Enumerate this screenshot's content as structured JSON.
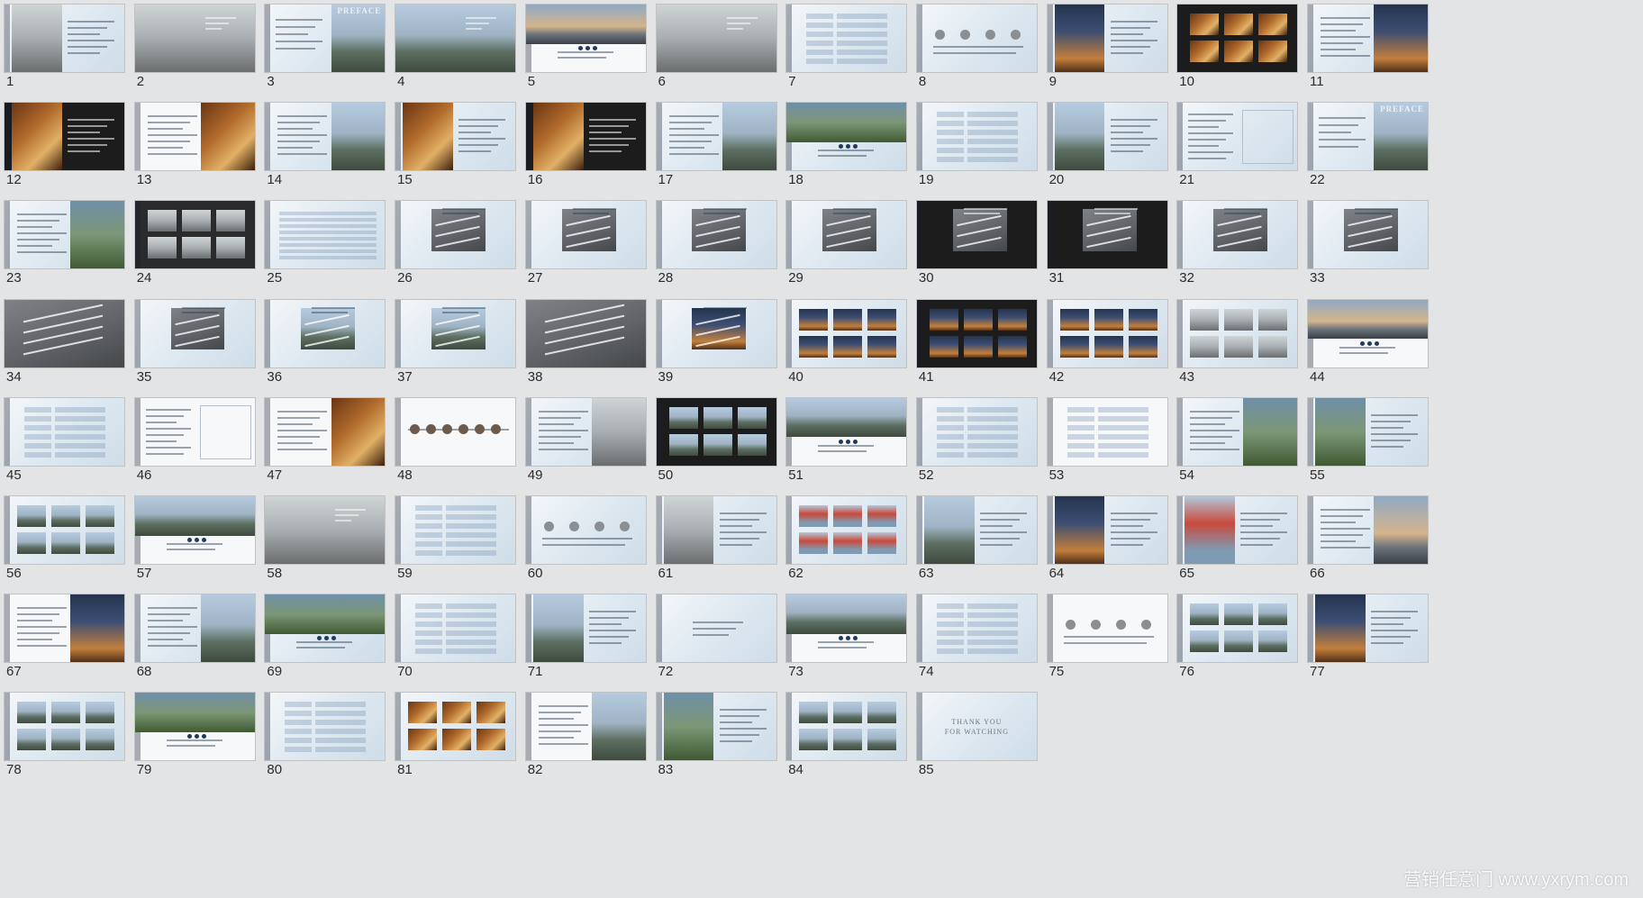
{
  "slides": [
    {
      "n": "1",
      "style": "light",
      "kind": "photo-left",
      "photo": "car"
    },
    {
      "n": "2",
      "style": "dark",
      "kind": "photo-full",
      "photo": "car"
    },
    {
      "n": "3",
      "style": "light",
      "kind": "preface",
      "photo": "city",
      "title": "PREFACE"
    },
    {
      "n": "4",
      "style": "light",
      "kind": "photo-full",
      "photo": "city"
    },
    {
      "n": "5",
      "style": "white",
      "kind": "photo-top",
      "photo": "sunset"
    },
    {
      "n": "6",
      "style": "light",
      "kind": "photo-full",
      "photo": "car"
    },
    {
      "n": "7",
      "style": "light",
      "kind": "rows"
    },
    {
      "n": "8",
      "style": "light",
      "kind": "circles"
    },
    {
      "n": "9",
      "style": "light",
      "kind": "photo-left",
      "photo": "night"
    },
    {
      "n": "10",
      "style": "black",
      "kind": "grid-photos",
      "photo": "food"
    },
    {
      "n": "11",
      "style": "light",
      "kind": "photo-right",
      "photo": "night"
    },
    {
      "n": "12",
      "style": "black",
      "kind": "photo-left",
      "photo": "food"
    },
    {
      "n": "13",
      "style": "white",
      "kind": "photo-right",
      "photo": "food"
    },
    {
      "n": "14",
      "style": "light",
      "kind": "photo-right",
      "photo": "city"
    },
    {
      "n": "15",
      "style": "light",
      "kind": "photo-left",
      "photo": "food"
    },
    {
      "n": "16",
      "style": "black",
      "kind": "photo-left",
      "photo": "food"
    },
    {
      "n": "17",
      "style": "light",
      "kind": "photo-right",
      "photo": "city"
    },
    {
      "n": "18",
      "style": "light",
      "kind": "photo-top",
      "photo": "green"
    },
    {
      "n": "19",
      "style": "light",
      "kind": "rows"
    },
    {
      "n": "20",
      "style": "light",
      "kind": "photo-left",
      "photo": "city"
    },
    {
      "n": "21",
      "style": "light",
      "kind": "text-map"
    },
    {
      "n": "22",
      "style": "light",
      "kind": "preface",
      "photo": "city",
      "title": "PREFACE"
    },
    {
      "n": "23",
      "style": "light",
      "kind": "photo-right",
      "photo": "green"
    },
    {
      "n": "24",
      "style": "dark",
      "kind": "grid-photos",
      "photo": "car"
    },
    {
      "n": "25",
      "style": "light",
      "kind": "table"
    },
    {
      "n": "26",
      "style": "light",
      "kind": "render",
      "photo": "3d"
    },
    {
      "n": "27",
      "style": "light",
      "kind": "render",
      "photo": "3d"
    },
    {
      "n": "28",
      "style": "light",
      "kind": "render",
      "photo": "3d"
    },
    {
      "n": "29",
      "style": "light",
      "kind": "render",
      "photo": "3d"
    },
    {
      "n": "30",
      "style": "black",
      "kind": "render",
      "photo": "3d"
    },
    {
      "n": "31",
      "style": "black",
      "kind": "render",
      "photo": "3d"
    },
    {
      "n": "32",
      "style": "light",
      "kind": "render",
      "photo": "3d"
    },
    {
      "n": "33",
      "style": "light",
      "kind": "render",
      "photo": "3d"
    },
    {
      "n": "34",
      "style": "dark",
      "kind": "render-full",
      "photo": "3d"
    },
    {
      "n": "35",
      "style": "light",
      "kind": "render",
      "photo": "3d"
    },
    {
      "n": "36",
      "style": "light",
      "kind": "render",
      "photo": "city"
    },
    {
      "n": "37",
      "style": "light",
      "kind": "render",
      "photo": "city"
    },
    {
      "n": "38",
      "style": "dark",
      "kind": "render-full",
      "photo": "3d"
    },
    {
      "n": "39",
      "style": "light",
      "kind": "render",
      "photo": "night"
    },
    {
      "n": "40",
      "style": "light",
      "kind": "grid-photos",
      "photo": "night"
    },
    {
      "n": "41",
      "style": "black",
      "kind": "grid-photos",
      "photo": "night"
    },
    {
      "n": "42",
      "style": "light",
      "kind": "grid-photos",
      "photo": "night"
    },
    {
      "n": "43",
      "style": "light",
      "kind": "grid-photos",
      "photo": "car"
    },
    {
      "n": "44",
      "style": "white",
      "kind": "photo-top",
      "photo": "sunset"
    },
    {
      "n": "45",
      "style": "light",
      "kind": "rows"
    },
    {
      "n": "46",
      "style": "white",
      "kind": "text-map"
    },
    {
      "n": "47",
      "style": "white",
      "kind": "photo-right",
      "photo": "food"
    },
    {
      "n": "48",
      "style": "white",
      "kind": "timeline"
    },
    {
      "n": "49",
      "style": "light",
      "kind": "photo-right",
      "photo": "car"
    },
    {
      "n": "50",
      "style": "black",
      "kind": "grid-photos",
      "photo": "city"
    },
    {
      "n": "51",
      "style": "white",
      "kind": "photo-top",
      "photo": "city"
    },
    {
      "n": "52",
      "style": "light",
      "kind": "rows"
    },
    {
      "n": "53",
      "style": "white",
      "kind": "rows"
    },
    {
      "n": "54",
      "style": "light",
      "kind": "photo-right",
      "photo": "green"
    },
    {
      "n": "55",
      "style": "light",
      "kind": "photo-left",
      "photo": "green"
    },
    {
      "n": "56",
      "style": "light",
      "kind": "grid-photos",
      "photo": "city"
    },
    {
      "n": "57",
      "style": "white",
      "kind": "photo-top",
      "photo": "city"
    },
    {
      "n": "58",
      "style": "light",
      "kind": "photo-full",
      "photo": "car"
    },
    {
      "n": "59",
      "style": "light",
      "kind": "rows"
    },
    {
      "n": "60",
      "style": "light",
      "kind": "circles"
    },
    {
      "n": "61",
      "style": "light",
      "kind": "photo-left",
      "photo": "car"
    },
    {
      "n": "62",
      "style": "light",
      "kind": "grid-photos",
      "photo": "bridge"
    },
    {
      "n": "63",
      "style": "light",
      "kind": "photo-left",
      "photo": "city"
    },
    {
      "n": "64",
      "style": "light",
      "kind": "photo-left",
      "photo": "night"
    },
    {
      "n": "65",
      "style": "light",
      "kind": "photo-left",
      "photo": "bridge"
    },
    {
      "n": "66",
      "style": "light",
      "kind": "photo-right",
      "photo": "sunset"
    },
    {
      "n": "67",
      "style": "white",
      "kind": "photo-right",
      "photo": "night"
    },
    {
      "n": "68",
      "style": "light",
      "kind": "photo-right",
      "photo": "city"
    },
    {
      "n": "69",
      "style": "light",
      "kind": "photo-top",
      "photo": "green"
    },
    {
      "n": "70",
      "style": "light",
      "kind": "rows"
    },
    {
      "n": "71",
      "style": "light",
      "kind": "photo-left",
      "photo": "city"
    },
    {
      "n": "72",
      "style": "light",
      "kind": "title-only"
    },
    {
      "n": "73",
      "style": "white",
      "kind": "photo-top",
      "photo": "city"
    },
    {
      "n": "74",
      "style": "light",
      "kind": "rows"
    },
    {
      "n": "75",
      "style": "white",
      "kind": "circles"
    },
    {
      "n": "76",
      "style": "light",
      "kind": "grid-photos",
      "photo": "city"
    },
    {
      "n": "77",
      "style": "light",
      "kind": "photo-left",
      "photo": "night"
    },
    {
      "n": "78",
      "style": "light",
      "kind": "grid-photos",
      "photo": "city"
    },
    {
      "n": "79",
      "style": "white",
      "kind": "photo-top",
      "photo": "green"
    },
    {
      "n": "80",
      "style": "light",
      "kind": "rows"
    },
    {
      "n": "81",
      "style": "light",
      "kind": "grid-photos",
      "photo": "food"
    },
    {
      "n": "82",
      "style": "white",
      "kind": "photo-right",
      "photo": "city"
    },
    {
      "n": "83",
      "style": "light",
      "kind": "photo-left",
      "photo": "green"
    },
    {
      "n": "84",
      "style": "light",
      "kind": "grid-photos",
      "photo": "city"
    },
    {
      "n": "85",
      "style": "light",
      "kind": "thanks",
      "title": "THANK YOU\nFOR WATCHING"
    }
  ],
  "watermark": "营销任意门 www.yxrym.com"
}
